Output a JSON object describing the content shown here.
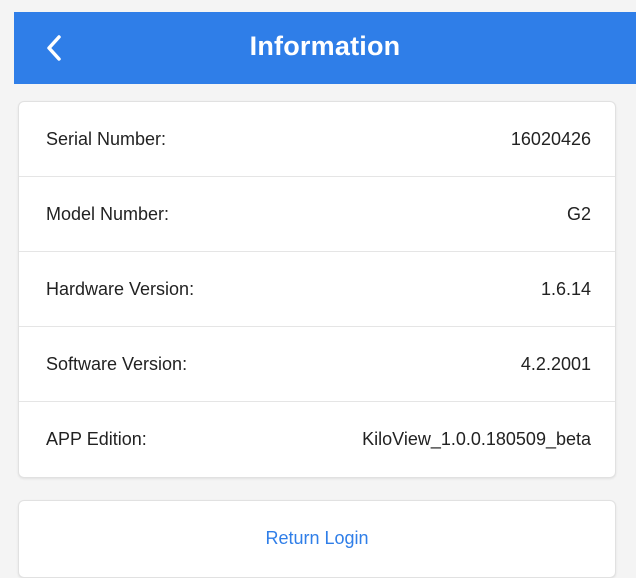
{
  "header": {
    "title": "Information",
    "back_icon": "chevron-left-icon",
    "background": "#2f7ee8"
  },
  "info": {
    "rows": [
      {
        "label": "Serial Number:",
        "value": "16020426"
      },
      {
        "label": "Model Number:",
        "value": "G2"
      },
      {
        "label": "Hardware Version:",
        "value": "1.6.14"
      },
      {
        "label": "Software Version:",
        "value": "4.2.2001"
      },
      {
        "label": "APP Edition:",
        "value": "KiloView_1.0.0.180509_beta"
      }
    ]
  },
  "actions": {
    "return_login_label": "Return Login"
  },
  "colors": {
    "accent": "#2f7ee8",
    "text": "#222222",
    "background": "#f4f4f4"
  }
}
